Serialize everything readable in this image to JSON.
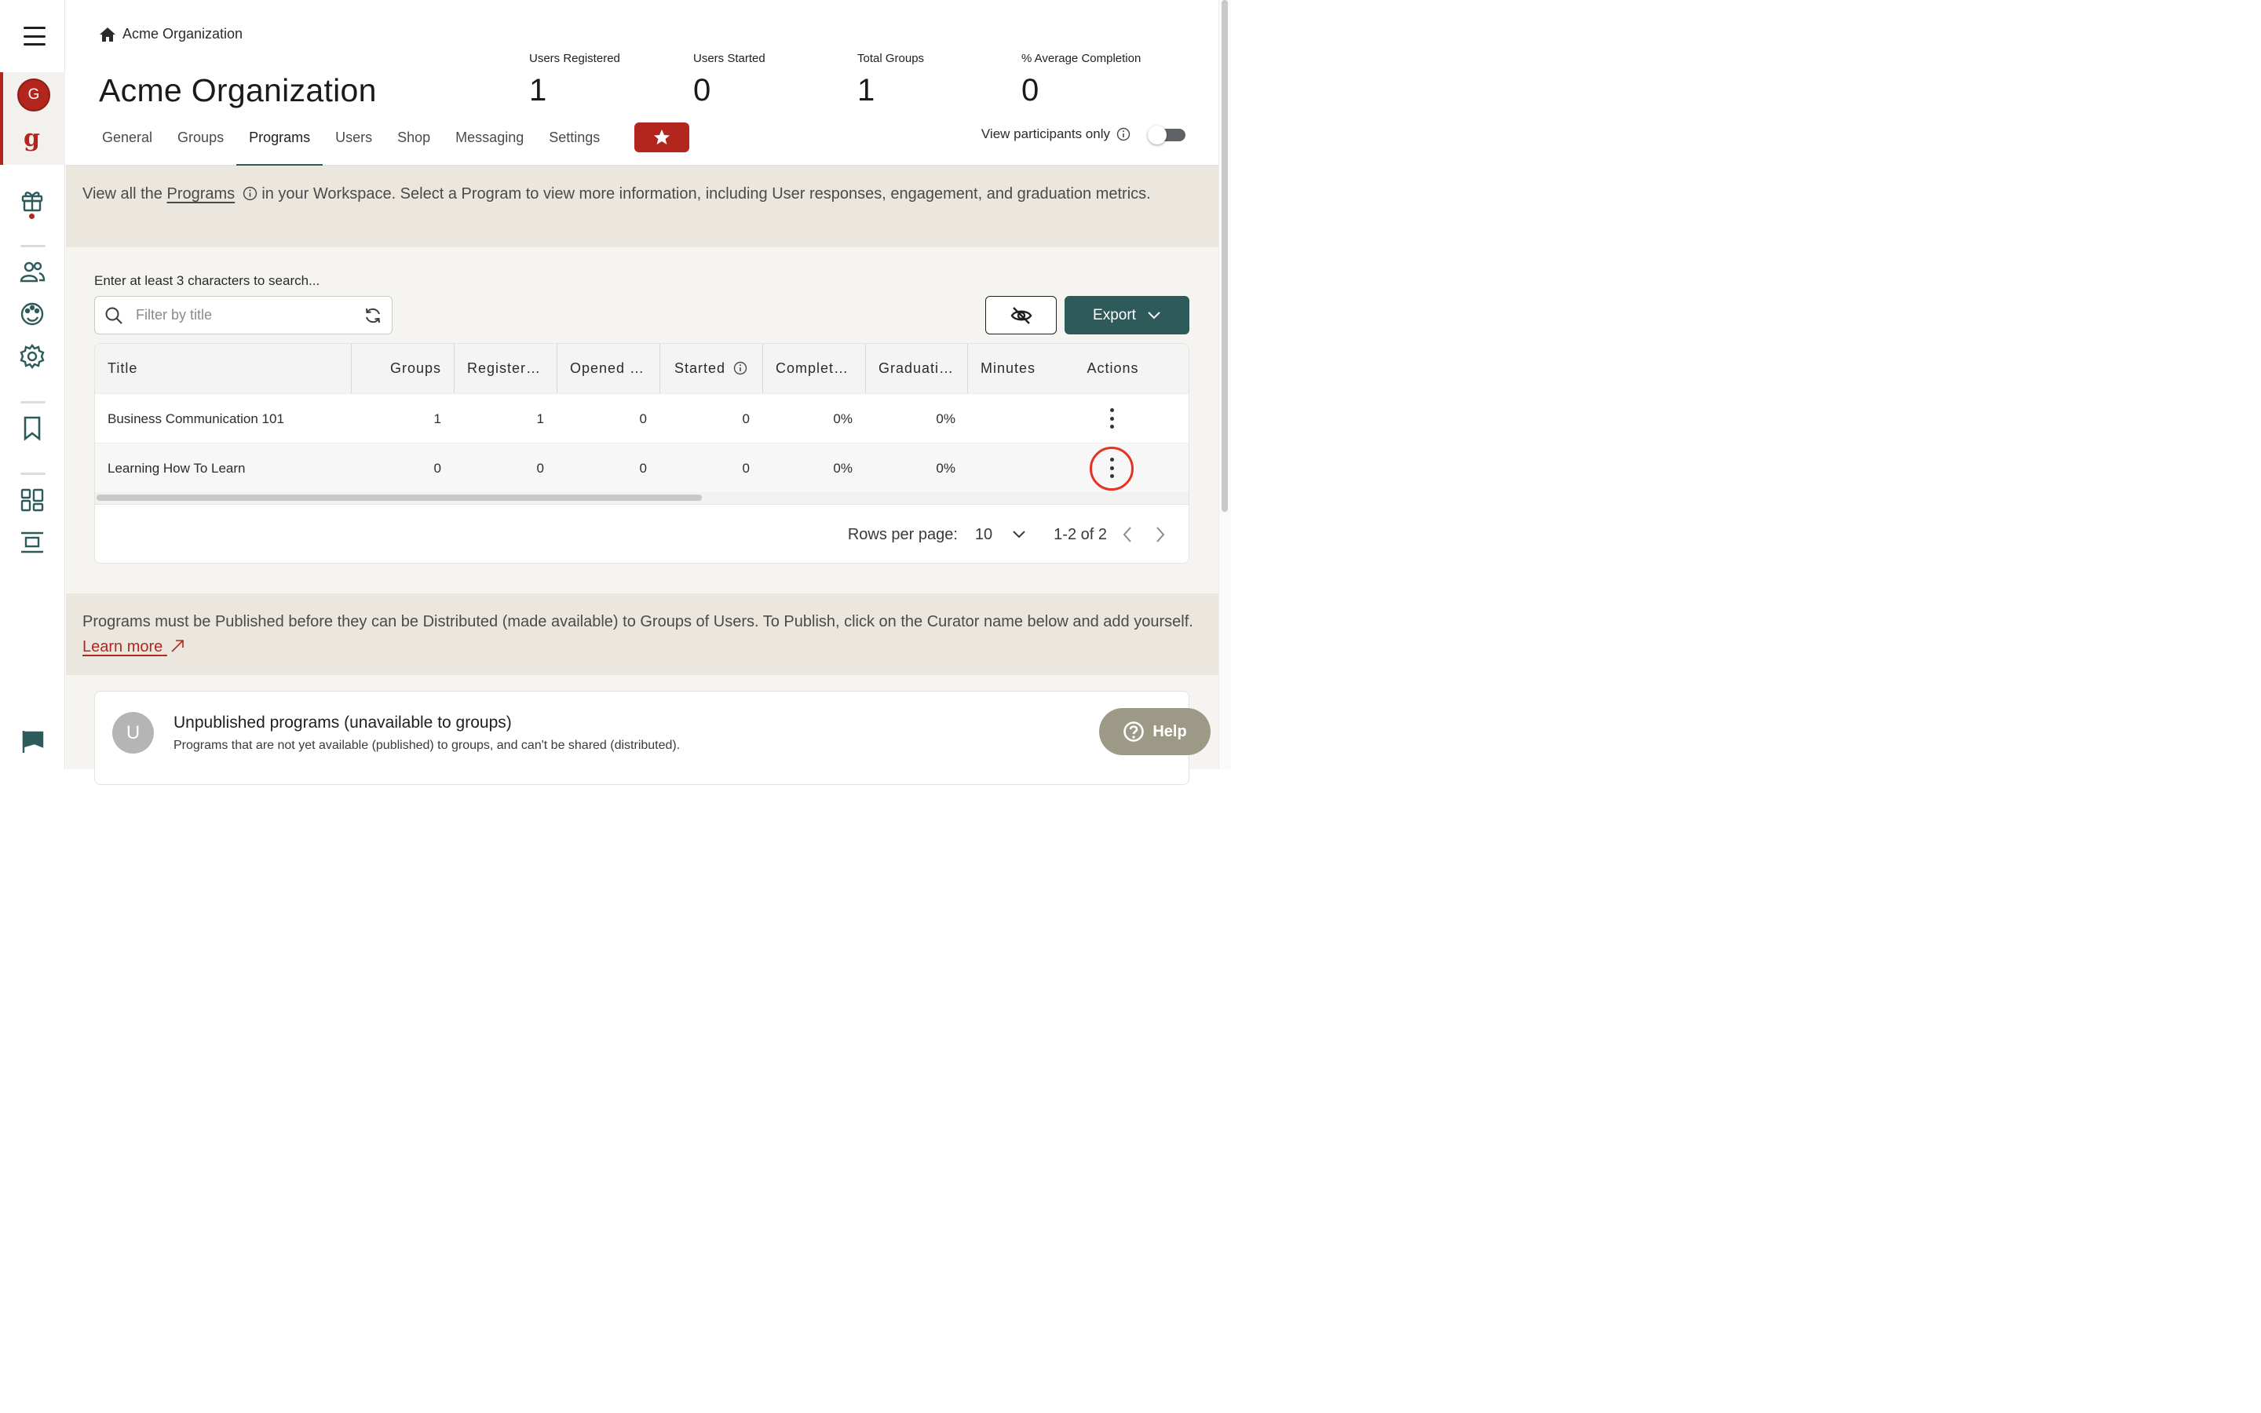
{
  "breadcrumb": {
    "label": "Acme Organization"
  },
  "org": {
    "title": "Acme Organization",
    "avatar_letter": "G",
    "brand_glyph": "g"
  },
  "stats": [
    {
      "label": "Users Registered",
      "value": "1"
    },
    {
      "label": "Users Started",
      "value": "0"
    },
    {
      "label": "Total Groups",
      "value": "1"
    },
    {
      "label": "% Average Completion",
      "value": "0"
    }
  ],
  "tabs": [
    "General",
    "Groups",
    "Programs",
    "Users",
    "Shop",
    "Messaging",
    "Settings"
  ],
  "active_tab": "Programs",
  "view_participants": {
    "label": "View participants only",
    "enabled": false
  },
  "intro": {
    "prefix": "View all the ",
    "link": "Programs",
    "suffix": " in your Workspace. Select a Program to view more information, including User responses, engagement, and graduation metrics."
  },
  "search": {
    "hint": "Enter at least 3 characters to search...",
    "placeholder": "Filter by title"
  },
  "export_label": "Export",
  "table": {
    "columns": [
      "Title",
      "Groups",
      "Register…",
      "Opened …",
      "Started",
      "Complet…",
      "Graduati…",
      "Minutes",
      "Actions"
    ],
    "rows": [
      {
        "title": "Business Communication 101",
        "groups": "1",
        "registered": "1",
        "opened": "0",
        "started": "0",
        "completed": "0%",
        "graduated": "0%",
        "minutes": ""
      },
      {
        "title": "Learning How To Learn",
        "groups": "0",
        "registered": "0",
        "opened": "0",
        "started": "0",
        "completed": "0%",
        "graduated": "0%",
        "minutes": ""
      }
    ]
  },
  "pagination": {
    "rows_label": "Rows per page:",
    "rows_value": "10",
    "range": "1-2 of 2"
  },
  "publish_note": {
    "text": "Programs must be Published before they can be Distributed (made available) to Groups of Users. To Publish, click on the Curator name below and add yourself. ",
    "link": "Learn more"
  },
  "unpublished": {
    "avatar_letter": "U",
    "title": "Unpublished programs (unavailable to groups)",
    "subtitle": "Programs that are not yet available (published) to groups, and can't be shared (distributed)."
  },
  "help_label": "Help",
  "colors": {
    "brand_red": "#b3261e",
    "teal": "#2e5a5a",
    "banner": "#ece7de",
    "highlight_ring": "#e53222"
  },
  "icons": [
    "menu-icon",
    "home-icon",
    "star-icon",
    "info-icon",
    "search-icon",
    "refresh-icon",
    "eye-off-icon",
    "chevron-down-icon",
    "chevron-left-icon",
    "chevron-right-icon",
    "gift-icon",
    "users-icon",
    "palette-icon",
    "gear-icon",
    "bookmark-icon",
    "dashboard-icon",
    "layout-icon",
    "flag-icon",
    "external-link-icon",
    "help-icon"
  ]
}
